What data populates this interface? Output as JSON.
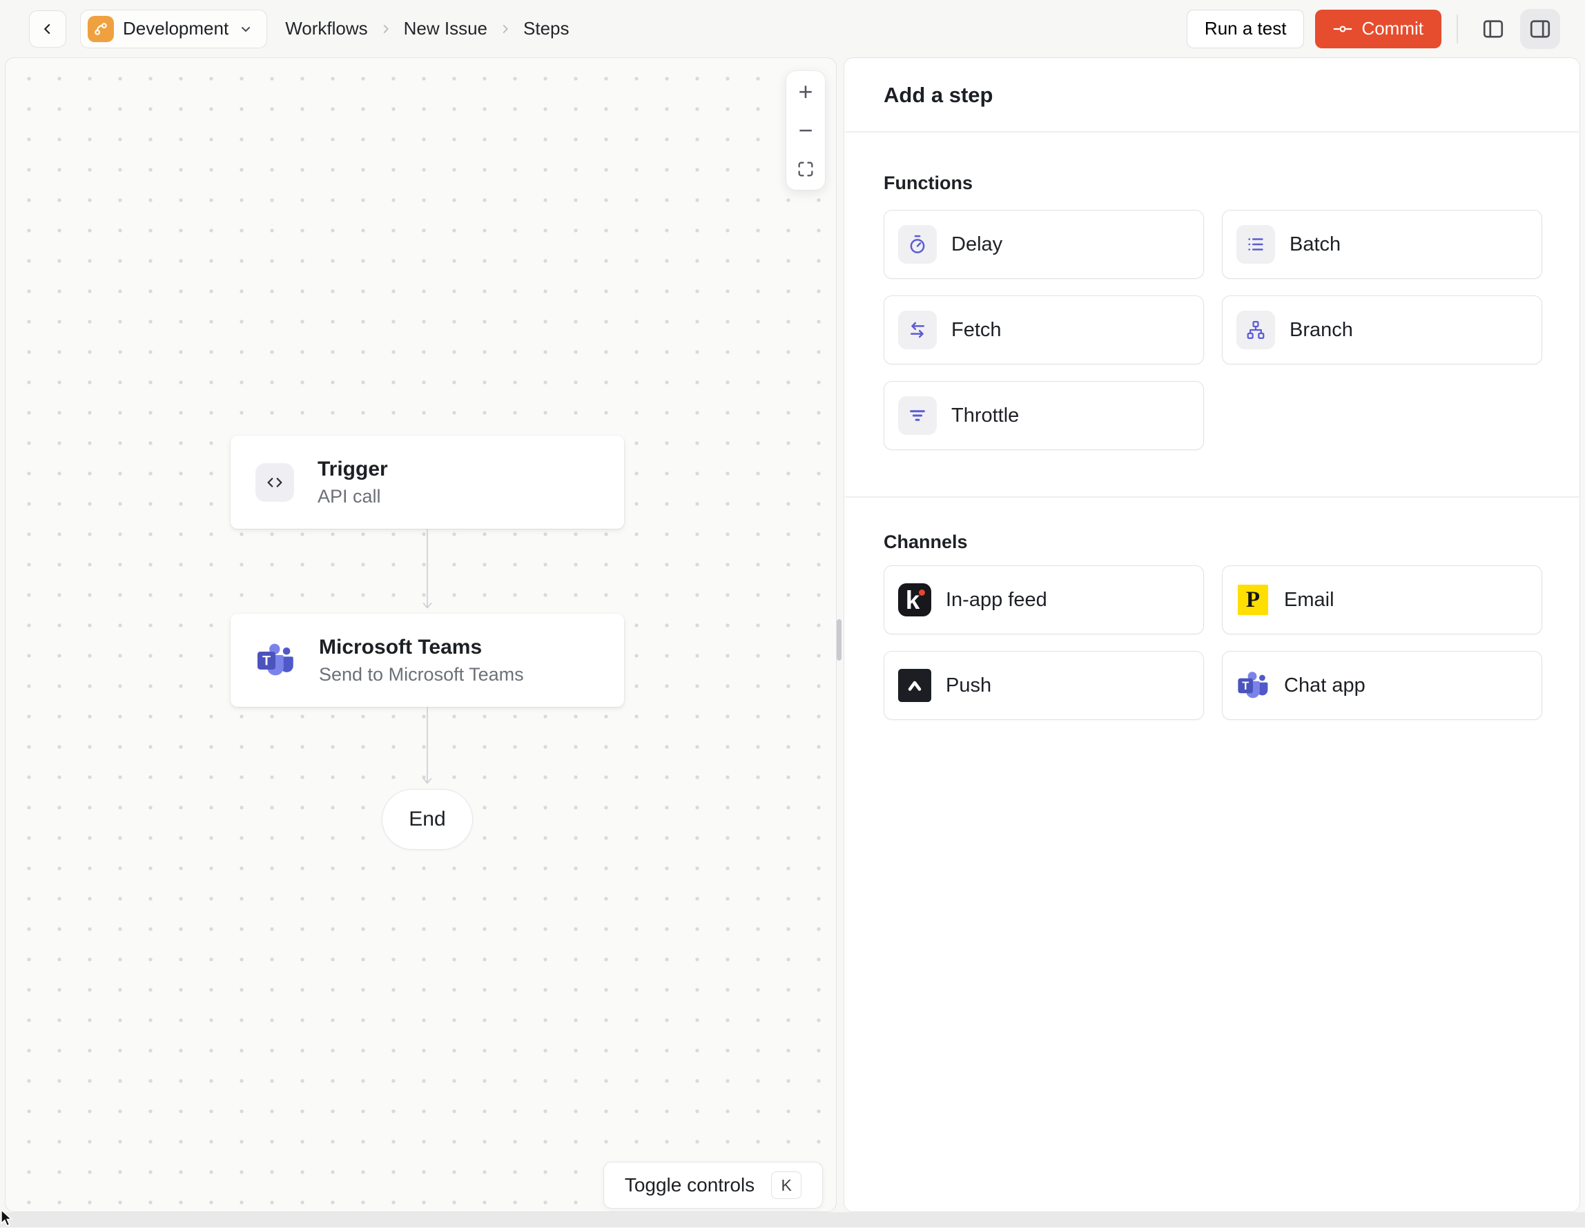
{
  "header": {
    "environment": {
      "label": "Development"
    },
    "breadcrumb": {
      "items": [
        "Workflows",
        "New Issue",
        "Steps"
      ]
    },
    "actions": {
      "run_test": "Run a test",
      "commit": "Commit"
    }
  },
  "canvas": {
    "zoom_controls": {
      "zoom_in": "+",
      "zoom_out": "−"
    },
    "nodes": {
      "trigger": {
        "title": "Trigger",
        "subtitle": "API call",
        "icon": "code-icon"
      },
      "teams": {
        "title": "Microsoft Teams",
        "subtitle": "Send to Microsoft Teams",
        "icon": "microsoft-teams-icon"
      },
      "end": {
        "label": "End"
      }
    },
    "toggle_controls": {
      "label": "Toggle controls",
      "shortcut": "K"
    }
  },
  "panel": {
    "title": "Add a step",
    "functions": {
      "heading": "Functions",
      "items": [
        {
          "label": "Delay",
          "icon": "stopwatch-icon"
        },
        {
          "label": "Batch",
          "icon": "list-icon"
        },
        {
          "label": "Fetch",
          "icon": "swap-arrows-icon"
        },
        {
          "label": "Branch",
          "icon": "branch-icon"
        },
        {
          "label": "Throttle",
          "icon": "filter-icon"
        }
      ]
    },
    "channels": {
      "heading": "Channels",
      "items": [
        {
          "label": "In-app feed",
          "icon": "knock-icon"
        },
        {
          "label": "Email",
          "icon": "postmark-icon"
        },
        {
          "label": "Push",
          "icon": "expo-icon"
        },
        {
          "label": "Chat app",
          "icon": "microsoft-teams-icon"
        }
      ]
    }
  },
  "glyphs": {
    "knock": "k",
    "postmark": "P",
    "teams_t": "T"
  },
  "colors": {
    "accent_commit": "#E54D2E",
    "accent_indigo": "#5B5BD6",
    "environment_badge": "#EFA13F",
    "knock_black": "#17171C",
    "knock_dot": "#E5472F",
    "postmark_yellow": "#FFDE02",
    "teams_dark": "#4B53BC",
    "teams_mid": "#7B83EB",
    "teams_light": "#5059C9"
  }
}
